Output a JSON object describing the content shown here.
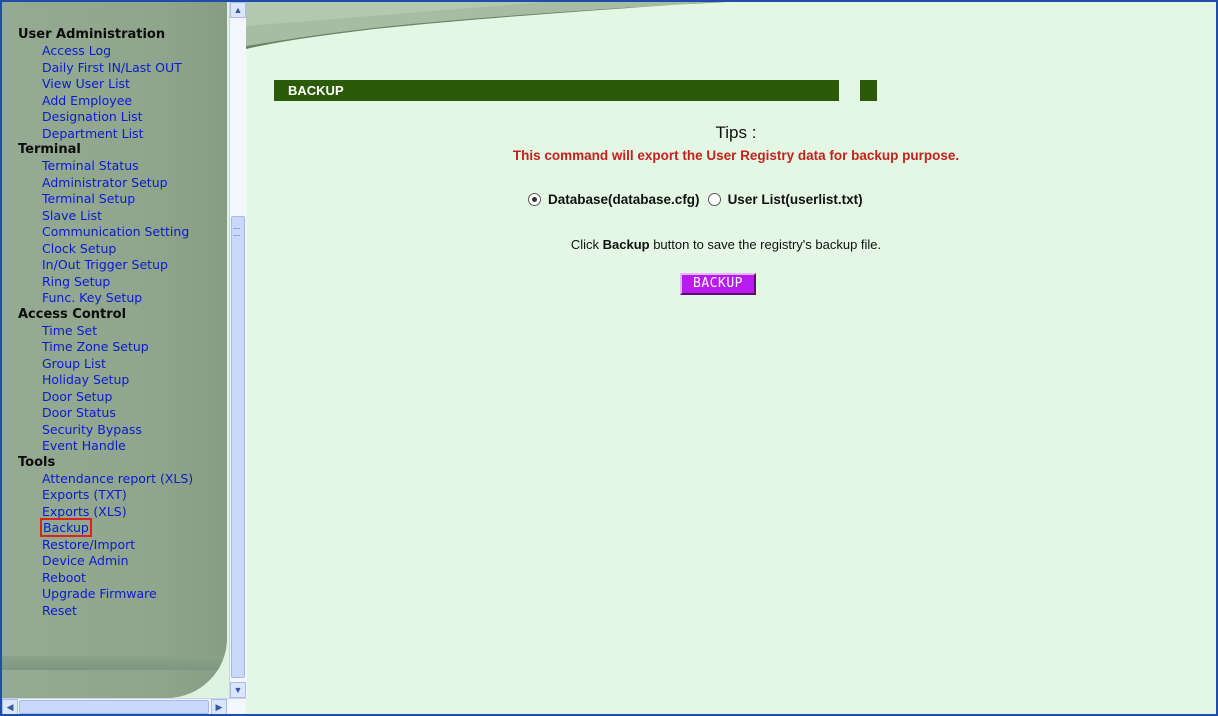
{
  "sidebar": {
    "sections": [
      {
        "heading": "User Administration",
        "items": [
          "Access Log",
          "Daily First IN/Last OUT",
          "View User List",
          "Add Employee",
          "Designation List",
          "Department List"
        ]
      },
      {
        "heading": "Terminal",
        "items": [
          "Terminal Status",
          "Administrator Setup",
          "Terminal Setup",
          "Slave List",
          "Communication Setting",
          "Clock Setup",
          "In/Out Trigger Setup",
          "Ring Setup",
          "Func. Key Setup"
        ]
      },
      {
        "heading": "Access Control",
        "items": [
          "Time Set",
          "Time Zone Setup",
          "Group List",
          "Holiday Setup",
          "Door Setup",
          "Door Status",
          "Security Bypass",
          "Event Handle"
        ]
      },
      {
        "heading": "Tools",
        "items": [
          "Attendance report (XLS)",
          "Exports (TXT)",
          "Exports (XLS)",
          "Backup",
          "Restore/Import",
          "Device Admin",
          "Reboot",
          "Upgrade Firmware",
          "Reset"
        ]
      }
    ],
    "active_item": "Backup"
  },
  "main": {
    "title": "BACKUP",
    "tips_title": "Tips :",
    "tips_message": "This command will export the User Registry data for backup purpose.",
    "options": [
      {
        "label": "Database(database.cfg)",
        "checked": true
      },
      {
        "label": "User List(userlist.txt)",
        "checked": false
      }
    ],
    "hint_prefix": "Click ",
    "hint_bold": "Backup",
    "hint_suffix": " button to save the registry's backup file.",
    "button_label": "BACKUP"
  },
  "colors": {
    "title_bar": "#2b5b08",
    "tips_message": "#c5211a",
    "button": "#b81af0",
    "nav_link": "#0a1cd0",
    "page_bg": "#e3f7e4",
    "active_outline": "#e0221c"
  }
}
